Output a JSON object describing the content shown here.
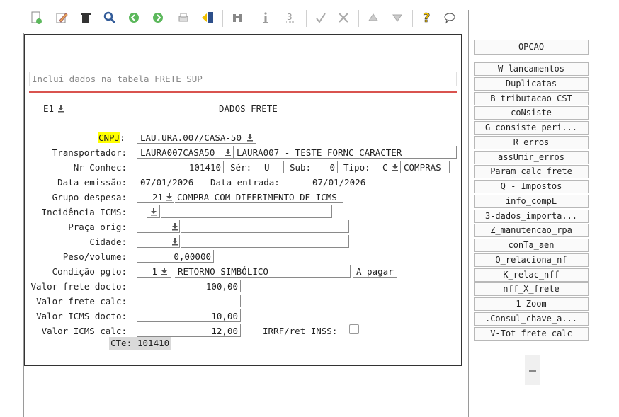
{
  "form": {
    "description": "Inclui dados na tabela FRETE_SUP",
    "selector": "E1",
    "title": "DADOS FRETE",
    "cnpj_label": "CNPJ",
    "cnpj_value": "LAU.URA.007/CASA-50",
    "transportador_label": "Transportador:",
    "transportador_code": "LAURA007CASA50",
    "transportador_name": "LAURA007 - TESTE FORNC CARACTER",
    "nr_conhec_label": "Nr Conhec:",
    "nr_conhec_value": "101410",
    "ser_label": "Sér:",
    "ser_value": "U",
    "sub_label": "Sub:",
    "sub_value": "0",
    "tipo_label": "Tipo:",
    "tipo_code": "C",
    "tipo_name": "COMPRAS",
    "data_emissao_label": "Data emissão:",
    "data_emissao_value": "07/01/2026",
    "data_entrada_label": "Data entrada:",
    "data_entrada_value": "07/01/2026",
    "grupo_despesa_label": "Grupo despesa:",
    "grupo_despesa_code": "21",
    "grupo_despesa_name": "COMPRA COM DIFERIMENTO DE ICMS",
    "incidencia_label": "Incidência ICMS:",
    "praca_label": "Praça orig:",
    "cidade_label": "Cidade:",
    "peso_label": "Peso/volume:",
    "peso_value": "0,00000",
    "condicao_label": "Condição pgto:",
    "condicao_code": "1",
    "condicao_name": "RETORNO SIMBÓLICO",
    "condicao_status": "A pagar",
    "vf_docto_label": "Valor frete docto:",
    "vf_docto_value": "100,00",
    "vf_calc_label": "Valor frete calc:",
    "vicms_docto_label": "Valor ICMS docto:",
    "vicms_docto_value": "10,00",
    "vicms_calc_label": "Valor ICMS calc:",
    "vicms_calc_value": "12,00",
    "irrf_label": "IRRF/ret INSS:",
    "cte_label": "CTe:",
    "cte_value": "101410"
  },
  "menu": {
    "header": "OPCAO",
    "items": [
      "W-lancamentos",
      "Duplicatas",
      "B_tributacao_CST",
      "coNsiste",
      "G_consiste_peri...",
      "R_erros",
      "assUmir_erros",
      "Param_calc_frete",
      "Q - Impostos",
      "info_compL",
      "3-dados_importa...",
      "Z_manutencao_rpa",
      "conTa_aen",
      "O_relaciona_nf",
      "K_relac_nff",
      "nff_X_frete",
      "1-Zoom",
      ".Consul_chave_a...",
      "V-Tot_frete_calc"
    ]
  },
  "colors": {
    "highlight": "#ffff00",
    "red_line": "#d9534f",
    "cte_bg": "#d9d9d9"
  }
}
